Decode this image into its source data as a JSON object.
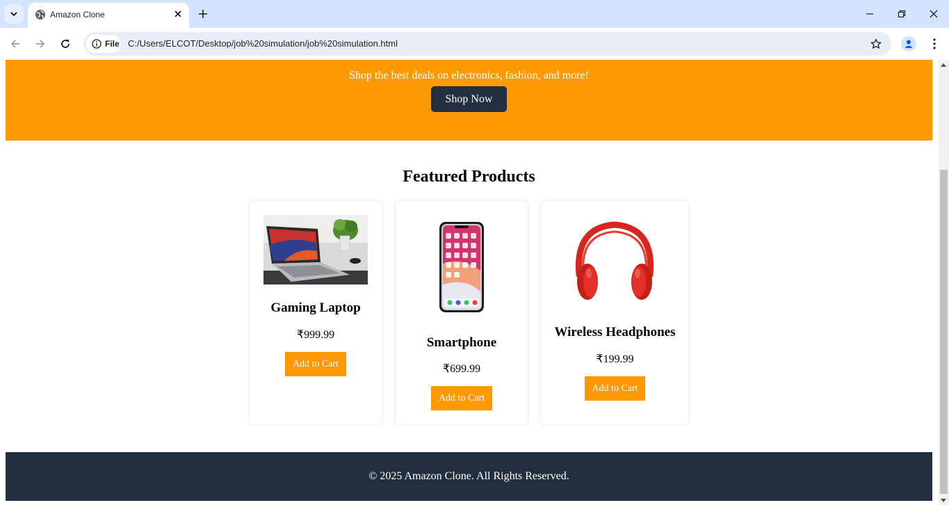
{
  "browser": {
    "tab_title": "Amazon Clone",
    "site_chip_label": "File",
    "url": "C:/Users/ELCOT/Desktop/job%20simulation/job%20simulation.html"
  },
  "hero": {
    "tagline": "Shop the best deals on electronics, fashion, and more!",
    "cta_label": "Shop Now"
  },
  "featured": {
    "title": "Featured Products",
    "products": [
      {
        "name": "Gaming Laptop",
        "price": "₹999.99",
        "button": "Add to Cart",
        "image": "laptop-image"
      },
      {
        "name": "Smartphone",
        "price": "₹699.99",
        "button": "Add to Cart",
        "image": "smartphone-image"
      },
      {
        "name": "Wireless Headphones",
        "price": "₹199.99",
        "button": "Add to Cart",
        "image": "headphones-image"
      }
    ]
  },
  "footer": {
    "text": "© 2025 Amazon Clone. All Rights Reserved."
  },
  "colors": {
    "accent": "#ff9900",
    "dark": "#232f3e",
    "tabbar": "#d3e3fd"
  }
}
